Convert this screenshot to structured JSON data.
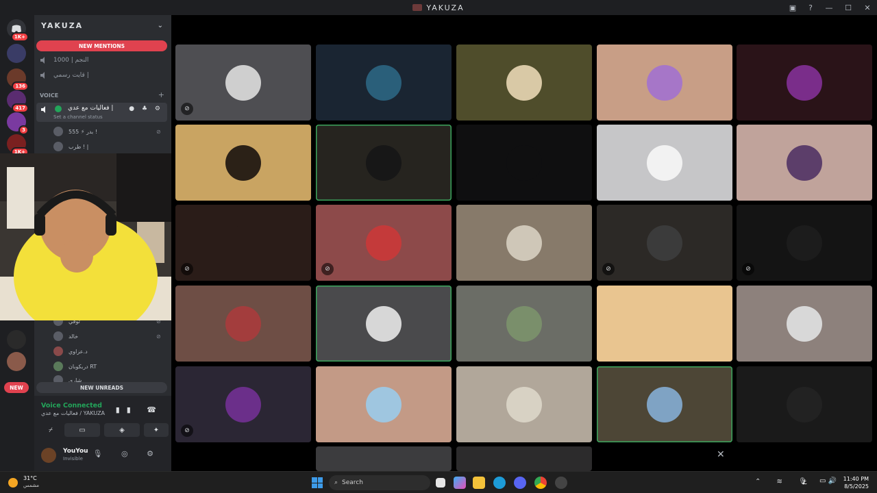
{
  "window": {
    "title": "YAKUZA"
  },
  "rail": {
    "badges": [
      "1K+",
      "136",
      "417",
      "3",
      "1K+"
    ],
    "new_label": "NEW"
  },
  "sidebar": {
    "server_name": "YAKUZA",
    "new_mentions": "NEW MENTIONS",
    "new_unreads": "NEW UNREADS",
    "channels": [
      {
        "label": "النجم | 1000"
      },
      {
        "label": "قايت رسمي |"
      }
    ],
    "voice_category": "VOICE",
    "active_voice": {
      "name": "فعاليات مع عدي |",
      "status": "Set a channel status"
    },
    "voice_users": [
      {
        "name": "555 ⚡ بدر !"
      },
      {
        "name": "طرب ! |"
      },
      {
        "name": "توفي"
      },
      {
        "name": "خالد"
      },
      {
        "name": "د.عزاوي"
      },
      {
        "name": "دربكوبان RT"
      },
      {
        "name": "شاري"
      }
    ]
  },
  "voice_panel": {
    "status": "Voice Connected",
    "channel": "فعاليات مع عدي / YAKUZA"
  },
  "user_panel": {
    "name": "YouYou",
    "status": "Invisible"
  },
  "tiles": [
    {
      "bg": "#4e4e52",
      "muted": true,
      "speaking": false,
      "avatar": "#cfcfcf"
    },
    {
      "bg": "#1a2532",
      "muted": false,
      "speaking": false,
      "avatar": "#2a5f7a"
    },
    {
      "bg": "#4f4d2b",
      "muted": false,
      "speaking": false,
      "avatar": "#d9c9a6"
    },
    {
      "bg": "#c89e86",
      "muted": false,
      "speaking": false,
      "avatar": "#a676c8"
    },
    {
      "bg": "#2a1318",
      "muted": false,
      "speaking": false,
      "avatar": "#7a2d8a"
    },
    {
      "bg": "#c9a462",
      "muted": false,
      "speaking": false,
      "avatar": "#2b2117"
    },
    {
      "bg": "#26241f",
      "muted": false,
      "speaking": true,
      "avatar": "#171717"
    },
    {
      "bg": "#0f0f10",
      "muted": false,
      "speaking": false,
      "avatar": "#0f0f10"
    },
    {
      "bg": "#c6c6c8",
      "muted": false,
      "speaking": false,
      "avatar": "#f2f2f2"
    },
    {
      "bg": "#c0a39b",
      "muted": false,
      "speaking": false,
      "avatar": "#5c3e6a"
    },
    {
      "bg": "#2a1c18",
      "muted": true,
      "speaking": false,
      "avatar": "#2a1c18"
    },
    {
      "bg": "#8d4a4a",
      "muted": true,
      "speaking": false,
      "avatar": "#c43a3a"
    },
    {
      "bg": "#877a6a",
      "muted": false,
      "speaking": false,
      "avatar": "#cfc7b8"
    },
    {
      "bg": "#2c2926",
      "muted": true,
      "speaking": false,
      "avatar": "#3b3b3b"
    },
    {
      "bg": "#141414",
      "muted": true,
      "speaking": false,
      "avatar": "#1c1c1c"
    },
    {
      "bg": "#6e4e45",
      "muted": false,
      "speaking": false,
      "avatar": "#a33d3d"
    },
    {
      "bg": "#4a4a4c",
      "muted": false,
      "speaking": true,
      "avatar": "#d7d7d7"
    },
    {
      "bg": "#6b6d66",
      "muted": false,
      "speaking": false,
      "avatar": "#7a8f6b"
    },
    {
      "bg": "#e9c590",
      "muted": false,
      "speaking": false,
      "avatar": "#e9c590"
    },
    {
      "bg": "#8d817c",
      "muted": false,
      "speaking": false,
      "avatar": "#d8d8d8"
    },
    {
      "bg": "#2b2634",
      "muted": true,
      "speaking": false,
      "avatar": "#6b2f8a"
    },
    {
      "bg": "#c39a86",
      "muted": false,
      "speaking": false,
      "avatar": "#9fc6e0"
    },
    {
      "bg": "#b1a79a",
      "muted": false,
      "speaking": false,
      "avatar": "#d8d2c4"
    },
    {
      "bg": "#4d4636",
      "muted": false,
      "speaking": true,
      "avatar": "#7fa3c4"
    },
    {
      "bg": "#1a1a1a",
      "muted": false,
      "speaking": false,
      "avatar": "#222222"
    }
  ],
  "taskbar": {
    "temperature": "31°C",
    "weather": "مشمس",
    "search_placeholder": "Search",
    "time": "11:40 PM",
    "date": "8/5/2025",
    "lang": "ع"
  }
}
